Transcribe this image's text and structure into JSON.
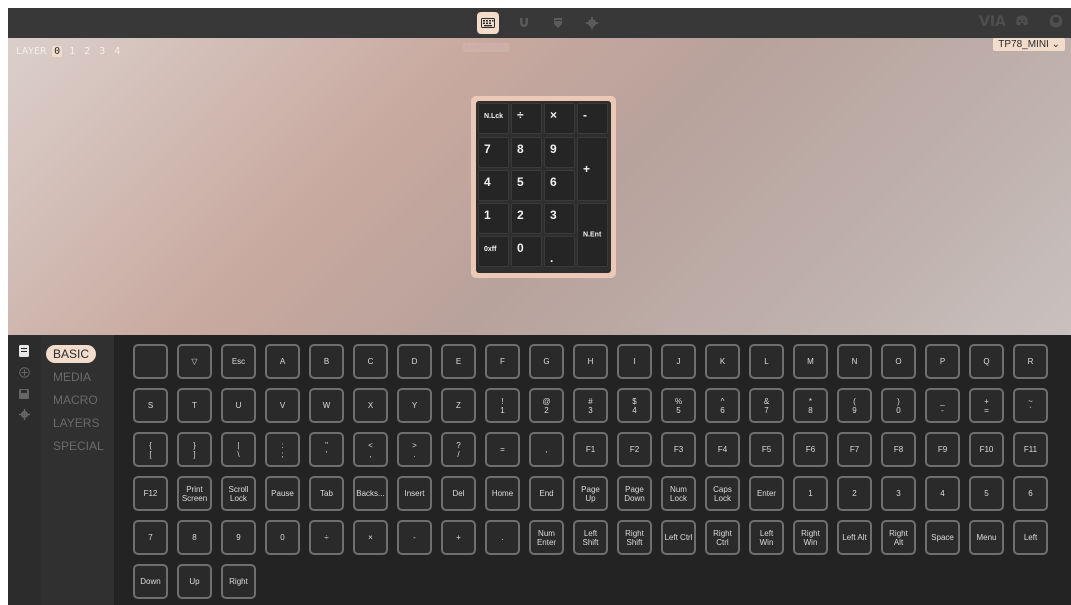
{
  "colors": {
    "accent": "#f2dccc",
    "topbar": "#383838",
    "panel": "#232323"
  },
  "topbar": {
    "tooltip": "CONFIGURE",
    "tabs": [
      {
        "name": "configure",
        "icon": "keyboard-icon",
        "active": true
      },
      {
        "name": "test",
        "icon": "magnet-icon",
        "active": false
      },
      {
        "name": "design",
        "icon": "pen-icon",
        "active": false
      },
      {
        "name": "settings",
        "icon": "gear-icon",
        "active": false
      }
    ],
    "brand": "VIA"
  },
  "stage": {
    "layer_label": "LAYER",
    "layers": [
      "0",
      "1",
      "2",
      "3",
      "4"
    ],
    "active_layer": "0",
    "keyboard": "TP78_MINI",
    "numpad": [
      "N.Lck",
      "÷",
      "×",
      "-",
      "7",
      "8",
      "9",
      "+",
      "4",
      "5",
      "6",
      "1",
      "2",
      "3",
      "N.Ent",
      "0xff",
      "0",
      "."
    ]
  },
  "sidebar": {
    "icons": [
      "keyboard-icon",
      "plus-circle-icon",
      "save-icon",
      "gear-icon"
    ],
    "menu": [
      "BASIC",
      "MEDIA",
      "MACRO",
      "LAYERS",
      "SPECIAL"
    ],
    "active": "BASIC"
  },
  "keys": [
    "",
    "▽",
    "Esc",
    "A",
    "B",
    "C",
    "D",
    "E",
    "F",
    "G",
    "H",
    "I",
    "J",
    "K",
    "L",
    "M",
    "N",
    "O",
    "P",
    "Q",
    "R",
    "S",
    "T",
    "U",
    "V",
    "W",
    "X",
    "Y",
    "Z",
    "!\n1",
    "@\n2",
    "#\n3",
    "$\n4",
    "%\n5",
    "^\n6",
    "&\n7",
    "*\n8",
    "(\n9",
    ")\n0",
    "_\n-",
    "+\n=",
    "~\n`",
    "{\n[",
    "}\n]",
    "|\n\\",
    ":\n;",
    "\"\n'",
    "<\n,",
    ">\n.",
    "?\n/",
    "=",
    ",",
    "F1",
    "F2",
    "F3",
    "F4",
    "F5",
    "F6",
    "F7",
    "F8",
    "F9",
    "F10",
    "F11",
    "F12",
    "Print\nScreen",
    "Scroll\nLock",
    "Pause",
    "Tab",
    "Backs...",
    "Insert",
    "Del",
    "Home",
    "End",
    "Page\nUp",
    "Page\nDown",
    "Num\nLock",
    "Caps\nLock",
    "Enter",
    "1",
    "2",
    "3",
    "4",
    "5",
    "6",
    "7",
    "8",
    "9",
    "0",
    "÷",
    "×",
    "-",
    "+",
    ".",
    "Num\nEnter",
    "Left\nShift",
    "Right\nShift",
    "Left Ctrl",
    "Right\nCtrl",
    "Left\nWin",
    "Right\nWin",
    "Left Alt",
    "Right\nAlt",
    "Space",
    "Menu",
    "Left",
    "Down",
    "Up",
    "Right"
  ]
}
